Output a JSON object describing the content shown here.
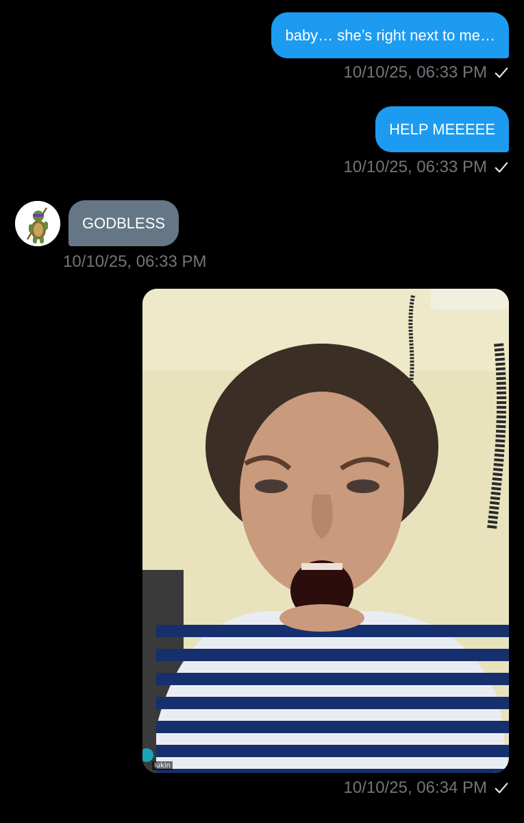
{
  "messages": [
    {
      "text": "baby… she’s right next to me…",
      "timestamp": "10/10/25, 06:33 PM",
      "direction": "outgoing"
    },
    {
      "text": "HELP MEEEEE",
      "timestamp": "10/10/25, 06:33 PM",
      "direction": "outgoing"
    },
    {
      "text": "GODBLESS",
      "timestamp": "10/10/25, 06:33 PM",
      "direction": "incoming"
    },
    {
      "type": "image",
      "caption_watermark": "lukin",
      "timestamp": "10/10/25, 06:34 PM",
      "direction": "outgoing"
    }
  ],
  "colors": {
    "outgoing_bubble": "#1d9bf0",
    "incoming_bubble": "#657786",
    "timestamp": "#71767b",
    "background": "#000000"
  },
  "icons": {
    "read_receipt": "checkmark-icon",
    "avatar": "turtle-avatar"
  }
}
